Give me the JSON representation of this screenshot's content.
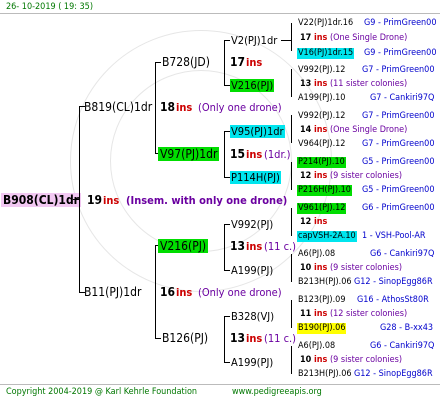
{
  "header": {
    "date": "26- 10-2019 ( 19: 35)"
  },
  "footer": {
    "copyright": "Copyright 2004-2019 @ Karl Kehrle Foundation",
    "url": "www.pedigreeapis.org"
  },
  "root": {
    "label": "B908(CL)1dr",
    "ins_count": "19",
    "ins_word": "ins",
    "note": "(Insem. with only one drone)"
  },
  "parents": {
    "upper": {
      "label": "B819(CL)1dr",
      "ins_count": "18",
      "ins_word": "ins",
      "note": "(Only one drone)"
    },
    "lower": {
      "label": "B11(PJ)1dr",
      "ins_count": "16",
      "ins_word": "ins",
      "note": "(Only one drone)"
    }
  },
  "grandparents": {
    "g1": {
      "label": "B728(JD)",
      "ins_count": "17",
      "ins_word": "ins"
    },
    "g2": {
      "label": "V97(PJ)1dr",
      "ins_count": "15",
      "ins_word": "ins",
      "note": "(1dr.)"
    },
    "g3": {
      "label": "V216(PJ)",
      "ins_count": "13",
      "ins_word": "ins",
      "note": "(11 c.)"
    },
    "g4": {
      "label": "B126(PJ)",
      "ins_count": "13",
      "ins_word": "ins",
      "note": "(11 c.)"
    }
  },
  "great_grandparents": {
    "gg1": {
      "label": "V2(PJ)1dr"
    },
    "gg2": {
      "label": "V216(PJ)"
    },
    "gg3": {
      "label": "V95(PJ)1dr",
      "ins_count": "14",
      "ins_word": "ins"
    },
    "gg4": {
      "label": "P114H(PJ)"
    },
    "gg5": {
      "label": "V992(PJ)",
      "ins_count": "12",
      "ins_word": "ins"
    },
    "gg6": {
      "label": "A199(PJ)",
      "ins_count": "10",
      "ins_word": "ins"
    },
    "gg7": {
      "label": "B328(VJ)",
      "ins_count": "11",
      "ins_word": "ins"
    },
    "gg8": {
      "label": "A199(PJ)",
      "ins_count": "10",
      "ins_word": "ins"
    }
  },
  "col4": {
    "r1": {
      "label": "V22(PJ)1dr.16",
      "suffix": "G9 - PrimGreen00"
    },
    "r2": {
      "count": "17",
      "ins_word": "ins",
      "note": "(One Single Drone)"
    },
    "r3": {
      "label": "V16(PJ)1dr.15",
      "suffix": "G9 - PrimGreen00"
    },
    "r4": {
      "label": "V992(PJ).12",
      "suffix": "G7 - PrimGreen00"
    },
    "r5": {
      "count": "13",
      "ins_word": "ins",
      "note": "(11 sister colonies)"
    },
    "r6": {
      "label": "A199(PJ).10",
      "suffix": "G7 - Cankiri97Q"
    },
    "r7": {
      "label": "V992(PJ).12",
      "suffix": "G7 - PrimGreen00"
    },
    "r8": {
      "count": "14",
      "ins_word": "ins",
      "note": "(One Single Drone)"
    },
    "r9": {
      "label": "V964(PJ).12",
      "suffix": "G7 - PrimGreen00"
    },
    "r10": {
      "label": "P214(PJ).10",
      "suffix": "G5 - PrimGreen00"
    },
    "r11": {
      "count": "12",
      "ins_word": "ins",
      "note": "(9 sister colonies)"
    },
    "r12": {
      "label": "P216H(PJ).10",
      "suffix": "G5 - PrimGreen00"
    },
    "r13": {
      "label": "V961(PJ).12",
      "suffix": "G6 - PrimGreen00"
    },
    "r14": {
      "count": "12",
      "ins_word": "ins"
    },
    "r15": {
      "label": "capVSH-2A.10",
      "suffix": "1 - VSH-Pool-AR"
    },
    "r16": {
      "label": "A6(PJ).08",
      "suffix": "G6 - Cankiri97Q"
    },
    "r17": {
      "count": "10",
      "ins_word": "ins",
      "note": "(9 sister colonies)"
    },
    "r18": {
      "label": "B213H(PJ).06",
      "suffix": "G12 - SinopEgg86R"
    },
    "r19": {
      "label": "B123(PJ).09",
      "suffix": "G16 - AthosSt80R"
    },
    "r20": {
      "count": "11",
      "ins_word": "ins",
      "note": "(12 sister colonies)"
    },
    "r21": {
      "label": "B190(PJ).06",
      "suffix": "G28 - B-xx43"
    },
    "r22": {
      "label": "A6(PJ).08",
      "suffix": "G6 - Cankiri97Q"
    },
    "r23": {
      "count": "10",
      "ins_word": "ins",
      "note": "(9 sister colonies)"
    },
    "r24": {
      "label": "B213H(PJ).06",
      "suffix": "G12 - SinopEgg86R"
    }
  }
}
